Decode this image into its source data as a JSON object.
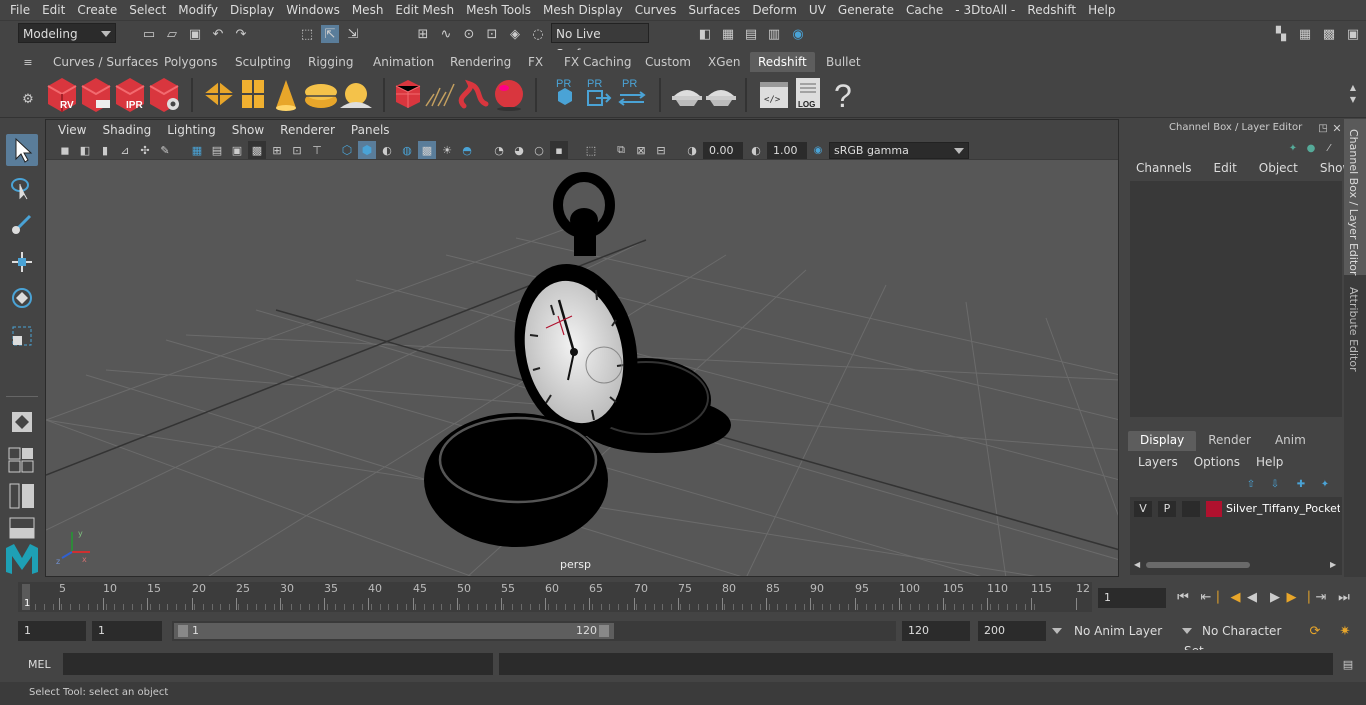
{
  "menubar": {
    "items": [
      "File",
      "Edit",
      "Create",
      "Select",
      "Modify",
      "Display",
      "Windows",
      "Mesh",
      "Edit Mesh",
      "Mesh Tools",
      "Mesh Display",
      "Curves",
      "Surfaces",
      "Deform",
      "UV",
      "Generate",
      "Cache",
      "- 3DtoAll -",
      "Redshift",
      "Help"
    ]
  },
  "statusline": {
    "workspace": "Modeling",
    "live_surface": "No Live Surface"
  },
  "shelf_tabs": [
    "Curves / Surfaces",
    "Polygons",
    "Sculpting",
    "Rigging",
    "Animation",
    "Rendering",
    "FX",
    "FX Caching",
    "Custom",
    "XGen",
    "Redshift",
    "Bullet"
  ],
  "shelf_active": "Redshift",
  "shelf_icons": {
    "rv": "RV",
    "ipr": "IPR",
    "pr1": "PR",
    "pr2": "PR",
    "pr3": "PR",
    "log": "LOG",
    "help": "?"
  },
  "viewport": {
    "menu": [
      "View",
      "Shading",
      "Lighting",
      "Show",
      "Renderer",
      "Panels"
    ],
    "exposure": "0.00",
    "gamma": "1.00",
    "color_space": "sRGB gamma",
    "camera_label": "persp"
  },
  "channel_box": {
    "title": "Channel Box / Layer Editor",
    "menu": [
      "Channels",
      "Edit",
      "Object",
      "Show"
    ]
  },
  "layer_editor": {
    "tabs": [
      "Display",
      "Render",
      "Anim"
    ],
    "active_tab": "Display",
    "menu": [
      "Layers",
      "Options",
      "Help"
    ],
    "layer": {
      "v": "V",
      "p": "P",
      "name": "Silver_Tiffany_Pocket_W",
      "color": "#b0112e"
    }
  },
  "side_tabs": [
    "Channel Box / Layer Editor",
    "Attribute Editor"
  ],
  "timeline": {
    "ticks": [
      "5",
      "10",
      "15",
      "20",
      "25",
      "30",
      "35",
      "40",
      "45",
      "50",
      "55",
      "60",
      "65",
      "70",
      "75",
      "80",
      "85",
      "90",
      "95",
      "100",
      "105",
      "110",
      "115",
      "12"
    ],
    "start_marker": "1",
    "current_frame": "1"
  },
  "range": {
    "start": "1",
    "playback_start": "1",
    "slider_start": "1",
    "slider_end": "120",
    "playback_end": "120",
    "end": "200",
    "anim_layer": "No Anim Layer",
    "char_set": "No Character Set"
  },
  "command_line": {
    "mode": "MEL"
  },
  "help_line": {
    "text": "Select Tool: select an object"
  }
}
